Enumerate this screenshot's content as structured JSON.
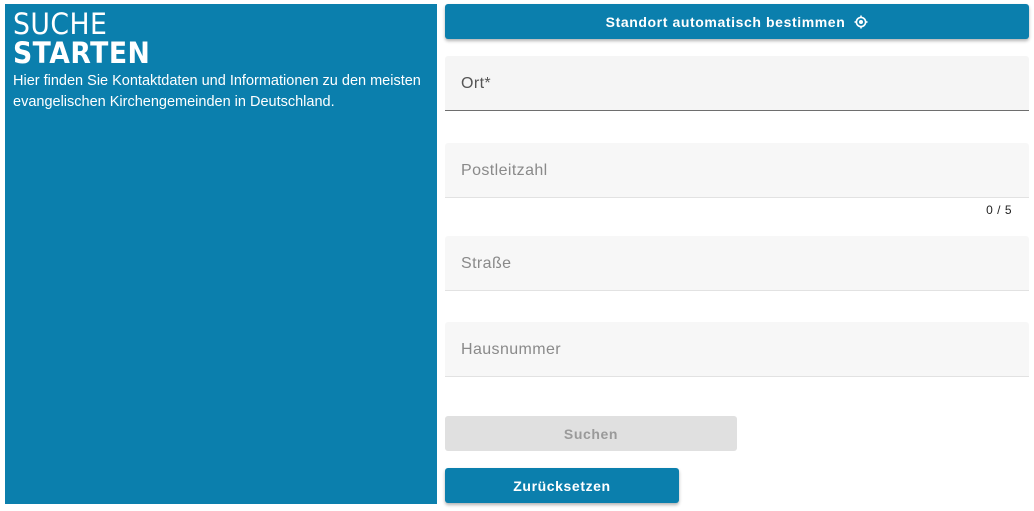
{
  "panel": {
    "title_line1": "Suche",
    "title_line2": "Starten",
    "intro": "Hier finden Sie Kontaktdaten und Informationen zu den meisten evangelischen Kirchengemeinden in Deutschland."
  },
  "form": {
    "locate_label": "Standort automatisch bestimmen",
    "locate_icon": "crosshair-icon",
    "ort": {
      "placeholder": "Ort*",
      "value": ""
    },
    "plz": {
      "placeholder": "Postleitzahl",
      "value": "",
      "counter": "0 / 5"
    },
    "strasse": {
      "placeholder": "Straße",
      "value": ""
    },
    "hausnummer": {
      "placeholder": "Hausnummer",
      "value": ""
    },
    "search_label": "Suchen",
    "reset_label": "Zurücksetzen"
  },
  "colors": {
    "brand": "#0b7fad",
    "disabled_bg": "#e0e0e0",
    "disabled_text": "#9a9a9a"
  }
}
